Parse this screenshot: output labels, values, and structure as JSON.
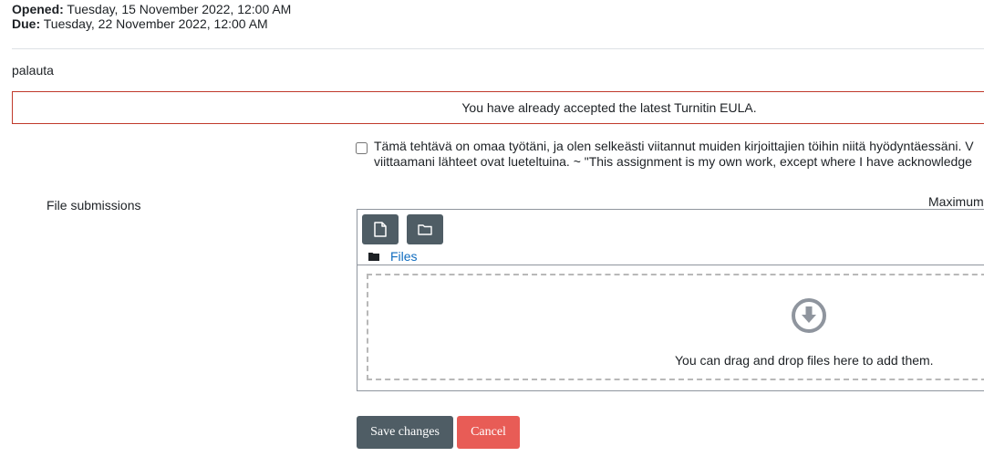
{
  "dates": {
    "opened_label": "Opened:",
    "opened_value": "Tuesday, 15 November 2022, 12:00 AM",
    "due_label": "Due:",
    "due_value": "Tuesday, 22 November 2022, 12:00 AM"
  },
  "intro": "palauta",
  "eula": "You have already accepted the latest Turnitin EULA.",
  "declaration": {
    "line1": "Tämä tehtävä on omaa työtäni, ja olen selkeästi viitannut muiden kirjoittajien töihin niitä hyödyntäessäni. V",
    "line2": "viittaamani lähteet ovat lueteltuina. ~ \"This assignment is my own work, except where I have acknowledge",
    "checked": false
  },
  "file_submissions": {
    "label": "File submissions",
    "maximum_label": "Maximum",
    "path_link": "Files",
    "drop_text": "You can drag and drop files here to add them."
  },
  "buttons": {
    "save": "Save changes",
    "cancel": "Cancel"
  },
  "colors": {
    "primary_button": "#4f5d65",
    "cancel_button": "#e85c56",
    "eula_border": "#c0392b",
    "link": "#0f6cbf"
  },
  "icons": {
    "add_file": "file-icon",
    "create_folder": "folder-icon",
    "path_folder": "folder-icon",
    "drop": "download-circle-icon"
  }
}
